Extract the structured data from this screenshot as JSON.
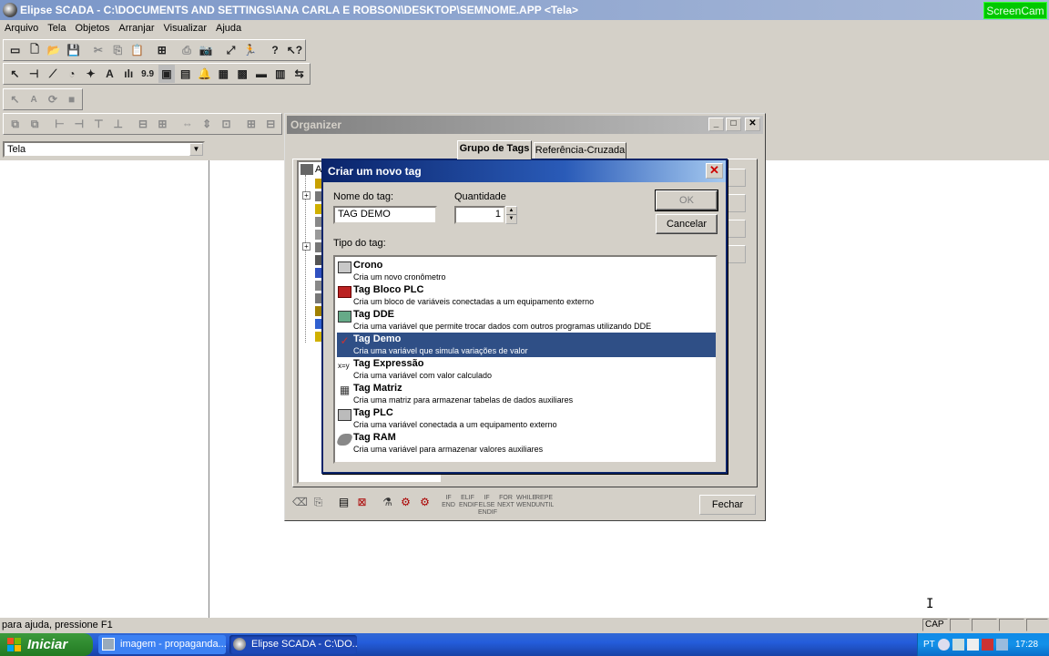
{
  "app": {
    "title": "Elipse SCADA - C:\\DOCUMENTS AND SETTINGS\\ANA CARLA E ROBSON\\DESKTOP\\SEMNOME.APP <Tela>",
    "screencam_label": "ScreenCam"
  },
  "menu": [
    "Arquivo",
    "Tela",
    "Objetos",
    "Arranjar",
    "Visualizar",
    "Ajuda"
  ],
  "screen_combo": {
    "value": "Tela"
  },
  "statusbar": {
    "help_text": "para ajuda, pressione F1",
    "caps": "CAP"
  },
  "taskbar": {
    "start_label": "Iniciar",
    "tasks": [
      {
        "label": "imagem - propaganda..."
      },
      {
        "label": "Elipse SCADA - C:\\DO..."
      }
    ],
    "lang": "PT",
    "clock": "17:28"
  },
  "organizer": {
    "title": "Organizer",
    "tabs": [
      "Grupo de Tags",
      "Referência-Cruzada"
    ],
    "close_label": "Fechar",
    "bottom_icons": [
      "IF END",
      "ELIF ENDIF",
      "IF ELSE ENDIF",
      "FOR NEXT",
      "WHILE WEND",
      "REPE UNTIL"
    ]
  },
  "dialog": {
    "title": "Criar um novo tag",
    "name_label": "Nome do tag:",
    "name_value": "TAG DEMO",
    "quantity_label": "Quantidade",
    "quantity_value": "1",
    "ok_label": "OK",
    "cancel_label": "Cancelar",
    "type_label": "Tipo do tag:",
    "types": [
      {
        "name": "Crono",
        "desc": "Cria um novo cronômetro",
        "icon": "stopwatch-icon"
      },
      {
        "name": "Tag Bloco PLC",
        "desc": "Cria um bloco de variáveis conectadas a um equipamento externo",
        "icon": "plc-block-icon"
      },
      {
        "name": "Tag DDE",
        "desc": "Cria uma variável que permite trocar dados com outros programas utilizando DDE",
        "icon": "dde-icon"
      },
      {
        "name": "Tag Demo",
        "desc": "Cria uma variável que simula variações de valor",
        "icon": "checkmark-wave-icon",
        "selected": true
      },
      {
        "name": "Tag Expressão",
        "desc": "Cria uma variável com valor calculado",
        "icon": "expression-icon"
      },
      {
        "name": "Tag Matriz",
        "desc": "Cria uma matriz para armazenar tabelas de dados auxiliares",
        "icon": "matrix-icon"
      },
      {
        "name": "Tag PLC",
        "desc": "Cria uma variável conectada a um equipamento externo",
        "icon": "plc-icon"
      },
      {
        "name": "Tag RAM",
        "desc": "Cria uma variável para armazenar valores auxiliares",
        "icon": "ram-icon"
      }
    ]
  },
  "colors": {
    "selection": "#2f4f86",
    "dialog_title": "#0a246a",
    "screencam": "#00c800"
  }
}
